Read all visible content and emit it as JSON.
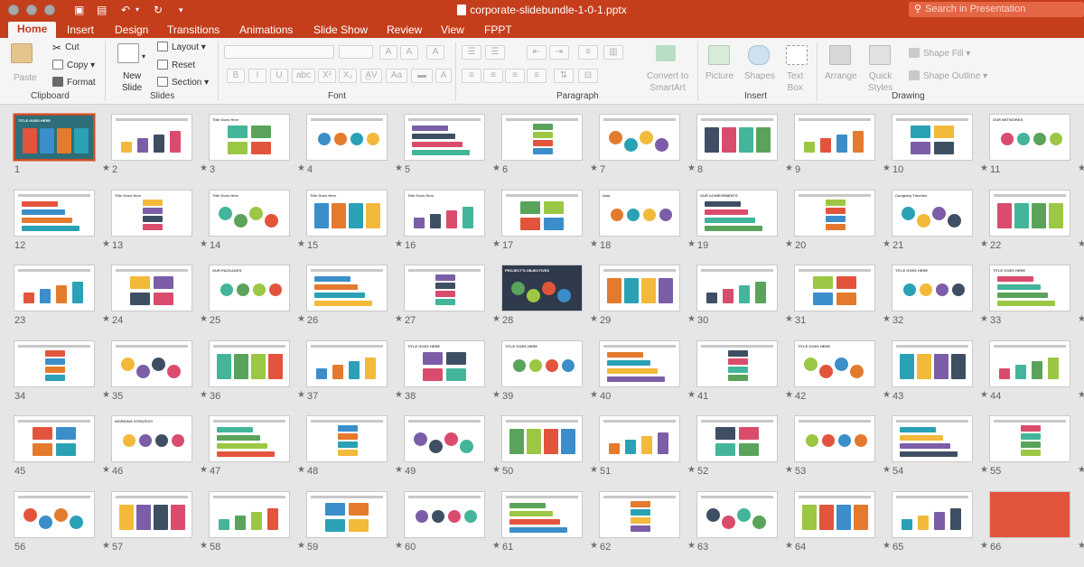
{
  "window": {
    "doc_title": "corporate-slidebundle-1-0-1.pptx",
    "search_placeholder": "Search in Presentation",
    "colors": {
      "accent": "#c43e1c",
      "ribbon": "#f5f5f5",
      "canvas": "#e6e6e6"
    }
  },
  "tabs": [
    "Home",
    "Insert",
    "Design",
    "Transitions",
    "Animations",
    "Slide Show",
    "Review",
    "View",
    "FPPT"
  ],
  "active_tab": "Home",
  "ribbon": {
    "clipboard": {
      "paste": "Paste",
      "cut": "Cut",
      "copy": "Copy",
      "format": "Format",
      "group": "Clipboard"
    },
    "slides": {
      "new_slide_1": "New",
      "new_slide_2": "Slide",
      "layout": "Layout",
      "reset": "Reset",
      "section": "Section",
      "group": "Slides"
    },
    "font": {
      "group": "Font",
      "buttons": [
        "B",
        "I",
        "U",
        "abc",
        "X²",
        "X₂",
        "A̲V",
        "Aa"
      ]
    },
    "paragraph": {
      "convert_1": "Convert to",
      "convert_2": "SmartArt",
      "group": "Paragraph"
    },
    "insert": {
      "picture": "Picture",
      "shapes": "Shapes",
      "textbox_1": "Text",
      "textbox_2": "Box",
      "group": "Insert"
    },
    "drawing": {
      "arrange": "Arrange",
      "quick_1": "Quick",
      "quick_2": "Styles",
      "shape_fill": "Shape Fill",
      "shape_outline": "Shape Outline",
      "group": "Drawing"
    }
  },
  "slides": [
    {
      "n": "1",
      "label": "TITLE GOES HERE"
    },
    {
      "n": "2"
    },
    {
      "n": "3",
      "label": "Title Goes Here"
    },
    {
      "n": "4"
    },
    {
      "n": "5"
    },
    {
      "n": "6"
    },
    {
      "n": "7"
    },
    {
      "n": "8"
    },
    {
      "n": "9"
    },
    {
      "n": "10"
    },
    {
      "n": "11",
      "label": "OUR NETWORKS"
    },
    {
      "n": "12"
    },
    {
      "n": "13",
      "label": "Title Goes Here"
    },
    {
      "n": "14",
      "label": "Title Goes Here"
    },
    {
      "n": "15",
      "label": "Title Goes Here"
    },
    {
      "n": "16",
      "label": "Title Goes Here"
    },
    {
      "n": "17"
    },
    {
      "n": "18",
      "label": "Asia"
    },
    {
      "n": "19",
      "label": "OUR ACHIEVEMENTS"
    },
    {
      "n": "20"
    },
    {
      "n": "21",
      "label": "Company Timeline"
    },
    {
      "n": "22"
    },
    {
      "n": "23"
    },
    {
      "n": "24"
    },
    {
      "n": "25",
      "label": "OUR PACKAGES"
    },
    {
      "n": "26"
    },
    {
      "n": "27"
    },
    {
      "n": "28",
      "label": "PROJECT'S OBJECTIVES"
    },
    {
      "n": "29"
    },
    {
      "n": "30"
    },
    {
      "n": "31"
    },
    {
      "n": "32",
      "label": "TITLE GOES HERE"
    },
    {
      "n": "33",
      "label": "TITLE GOES HERE"
    },
    {
      "n": "34"
    },
    {
      "n": "35"
    },
    {
      "n": "36"
    },
    {
      "n": "37"
    },
    {
      "n": "38",
      "label": "TITLE GOES HERE"
    },
    {
      "n": "39",
      "label": "TITLE GOES HERE"
    },
    {
      "n": "40"
    },
    {
      "n": "41"
    },
    {
      "n": "42",
      "label": "TITLE GOES HERE"
    },
    {
      "n": "43"
    },
    {
      "n": "44"
    },
    {
      "n": "45"
    },
    {
      "n": "46",
      "label": "WORKING STRATEGY"
    },
    {
      "n": "47"
    },
    {
      "n": "48"
    },
    {
      "n": "49"
    },
    {
      "n": "50"
    },
    {
      "n": "51"
    },
    {
      "n": "52"
    },
    {
      "n": "53"
    },
    {
      "n": "54"
    },
    {
      "n": "55"
    },
    {
      "n": "56"
    },
    {
      "n": "57"
    },
    {
      "n": "58"
    },
    {
      "n": "59"
    },
    {
      "n": "60"
    },
    {
      "n": "61"
    },
    {
      "n": "62"
    },
    {
      "n": "63"
    },
    {
      "n": "64"
    },
    {
      "n": "65"
    },
    {
      "n": "66"
    }
  ],
  "selected_slide": "1"
}
